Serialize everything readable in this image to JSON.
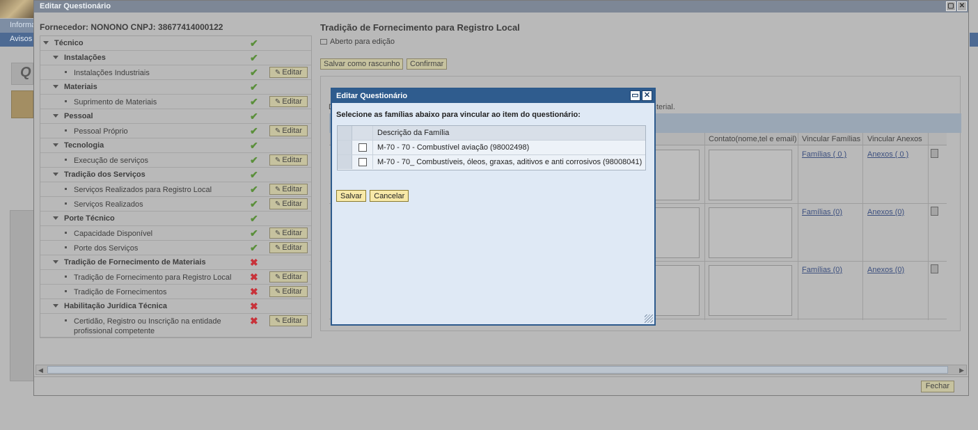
{
  "background": {
    "tab1": "Informa",
    "tab2": "Avisos",
    "title_fragment": "Q"
  },
  "window": {
    "title": "Editar Questionário",
    "max_icon": "maximize-icon",
    "close_icon": "close-icon"
  },
  "supplier": "Fornecedor: NONONO CNPJ: 38677414000122",
  "tree": [
    {
      "label": "Técnico",
      "type": "cat0",
      "status": "ok"
    },
    {
      "label": "Instalações",
      "type": "cat1",
      "status": "ok"
    },
    {
      "label": "Instalações Industriais",
      "type": "item",
      "status": "ok",
      "edit": "Editar"
    },
    {
      "label": "Materiais",
      "type": "cat1",
      "status": "ok"
    },
    {
      "label": "Suprimento de Materiais",
      "type": "item",
      "status": "ok",
      "edit": "Editar"
    },
    {
      "label": "Pessoal",
      "type": "cat1",
      "status": "ok"
    },
    {
      "label": "Pessoal Próprio",
      "type": "item",
      "status": "ok",
      "edit": "Editar"
    },
    {
      "label": "Tecnologia",
      "type": "cat1",
      "status": "ok"
    },
    {
      "label": "Execução de serviços",
      "type": "item",
      "status": "ok",
      "edit": "Editar"
    },
    {
      "label": "Tradição dos Serviços",
      "type": "cat1",
      "status": "ok"
    },
    {
      "label": "Serviços Realizados para Registro Local",
      "type": "item",
      "status": "ok",
      "edit": "Editar"
    },
    {
      "label": "Serviços Realizados",
      "type": "item",
      "status": "ok",
      "edit": "Editar"
    },
    {
      "label": "Porte Técnico",
      "type": "cat1",
      "status": "ok"
    },
    {
      "label": "Capacidade Disponível",
      "type": "item",
      "status": "ok",
      "edit": "Editar"
    },
    {
      "label": "Porte dos Serviços",
      "type": "item",
      "status": "ok",
      "edit": "Editar"
    },
    {
      "label": "Tradição de Fornecimento de Materiais",
      "type": "cat1",
      "status": "err"
    },
    {
      "label": "Tradição de Fornecimento para Registro Local",
      "type": "item",
      "status": "err",
      "edit": "Editar"
    },
    {
      "label": "Tradição de Fornecimentos",
      "type": "item",
      "status": "err",
      "edit": "Editar"
    },
    {
      "label": "Habilitação Jurídica Técnica",
      "type": "cat1",
      "status": "err"
    },
    {
      "label": "Certidão, Registro ou Inscrição na entidade profissional competente",
      "type": "item-tall",
      "status": "err",
      "edit": "Editar"
    }
  ],
  "right": {
    "title": "Tradição de Fornecimento para Registro Local",
    "status": "Aberto para edição",
    "save_draft": "Salvar como rascunho",
    "confirm": "Confirmar",
    "hint_start": "D",
    "hint_end": "terial.",
    "columns": {
      "contact": "Contato(nome,tel e email)",
      "families": "Vincular Famílias",
      "attachments": "Vincular Anexos"
    },
    "rows": [
      {
        "families": "Famílias ( 0 )",
        "attachments": "Anexos ( 0 )"
      },
      {
        "families": "Famílias (0)",
        "attachments": "Anexos (0)"
      },
      {
        "families": "Famílias (0)",
        "attachments": "Anexos (0)"
      }
    ]
  },
  "footer": {
    "close": "Fechar"
  },
  "modal": {
    "title": "Editar Questionário",
    "instruction": "Selecione as famílias abaixo para vincular ao item do questionário:",
    "column_header": "Descrição da Família",
    "families": [
      {
        "label": "M-70 - 70 - Combustível aviação (98002498)",
        "checked": false
      },
      {
        "label": "M-70 - 70_ Combustíveis, óleos, graxas, aditivos e anti corrosivos (98008041)",
        "checked": false
      }
    ],
    "save": "Salvar",
    "cancel": "Cancelar"
  },
  "colors": {
    "modal_title_bg": "#2f5c8e",
    "ok_icon": "#5a8f3a",
    "err_icon": "#c8323a",
    "button_bg": "#f8e9a8"
  }
}
